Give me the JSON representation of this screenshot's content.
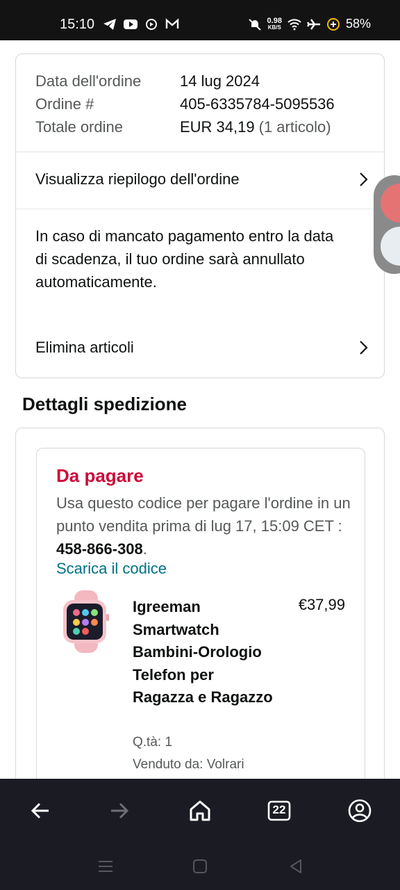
{
  "status_bar": {
    "time": "15:10",
    "net_speed_value": "0.98",
    "net_speed_unit": "KB/S",
    "battery": "58%",
    "icons": [
      "telegram-icon",
      "youtube-icon",
      "media-icon",
      "gmail-icon",
      "mute-icon",
      "wifi-icon",
      "airplane-icon",
      "battery-saver-icon"
    ]
  },
  "order_summary": {
    "rows": [
      {
        "label": "Data dell'ordine",
        "value": "14 lug 2024",
        "extra": ""
      },
      {
        "label": "Ordine #",
        "value": "405-6335784-5095536",
        "extra": ""
      },
      {
        "label": "Totale ordine",
        "value": "EUR 34,19",
        "extra": "(1 articolo)"
      }
    ],
    "view_summary_label": "Visualizza riepilogo dell'ordine",
    "notice": "In caso di mancato pagamento entro la data di scadenza, il tuo ordine sarà annullato automaticamente.",
    "delete_items_label": "Elimina articoli"
  },
  "shipping": {
    "section_title": "Dettagli spedizione",
    "status_title": "Da pagare",
    "instructions": "Usa questo codice per pagare l'ordine in un punto vendita prima di lug 17, 15:09 CET : ",
    "code": "458-866-308",
    "code_suffix": ".",
    "download_label": "Scarica il codice",
    "product": {
      "title": "Igreeman Smartwatch Bambini-Orologio Telefon per Ragazza e Ragazzo",
      "price": "€37,99",
      "quantity": "Q.tà: 1",
      "seller": "Venduto da: Volrari"
    }
  },
  "bottom_nav": {
    "tabs_count": "22",
    "items": [
      "back-icon",
      "forward-icon",
      "home-icon",
      "tabs-icon",
      "account-icon"
    ]
  },
  "colors": {
    "accent_red": "#cc0c39",
    "link_teal": "#007185",
    "nav_bg": "#1b1c23",
    "status_bg": "#131313"
  }
}
